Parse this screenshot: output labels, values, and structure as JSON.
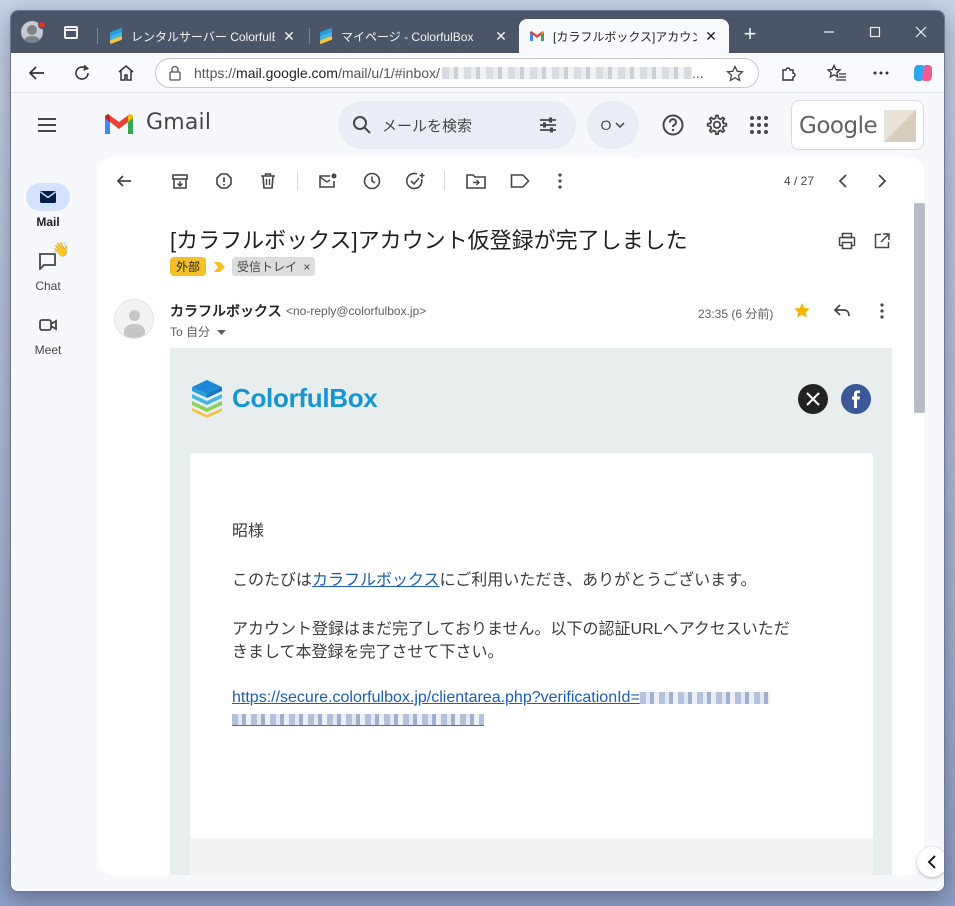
{
  "browser": {
    "tabs": [
      {
        "title": "レンタルサーバー ColorfulBox（",
        "active": false
      },
      {
        "title": "マイページ - ColorfulBox",
        "active": false
      },
      {
        "title": "[カラフルボックス]アカウント仮登",
        "active": true
      }
    ],
    "new_tab_label": "+",
    "close_glyph": "✕",
    "address": {
      "scheme_prefix": "https://",
      "host": "mail.google.com",
      "path": "/mail/u/1/#inbox/",
      "ellipsis": "..."
    }
  },
  "gmail": {
    "product_name": "Gmail",
    "search_placeholder": "メールを検索",
    "status_label": "O",
    "account_brand": "Google",
    "rail": [
      {
        "label": "Mail",
        "active": true
      },
      {
        "label": "Chat",
        "active": false
      },
      {
        "label": "Meet",
        "active": false
      }
    ],
    "pager": "4 / 27",
    "subject": "[カラフルボックス]アカウント仮登録が完了しました",
    "labels": {
      "external": "外部",
      "inbox": "受信トレイ",
      "inbox_remove": "×"
    },
    "message": {
      "sender_name": "カラフルボックス",
      "sender_email": "<no-reply@colorfulbox.jp>",
      "to_line": "To 自分",
      "timestamp": "23:35 (6 分前)"
    },
    "email_body": {
      "brand": "ColorfulBox",
      "greeting": "昭様",
      "line1_before": "このたびは",
      "line1_link": "カラフルボックス",
      "line1_after": "にご利用いただき、ありがとうございます。",
      "line2a": "アカウント登録はまだ完了しておりません。以下の認証URLへアクセスいただ",
      "line2b": "きまして本登録を完了させて下さい。",
      "verify_link": "https://secure.colorfulbox.jp/clientarea.php?verificationId="
    }
  },
  "colors": {
    "tabbar_bg": "#4b5568",
    "gmail_bg": "#f6f8fc",
    "search_bg": "#e9eef6",
    "rail_active": "#d3e3fd",
    "external_label": "#f6bf26",
    "link": "#1a5fb4",
    "brand_blue": "#1596d4",
    "star": "#f4b400",
    "facebook": "#3b5998"
  }
}
